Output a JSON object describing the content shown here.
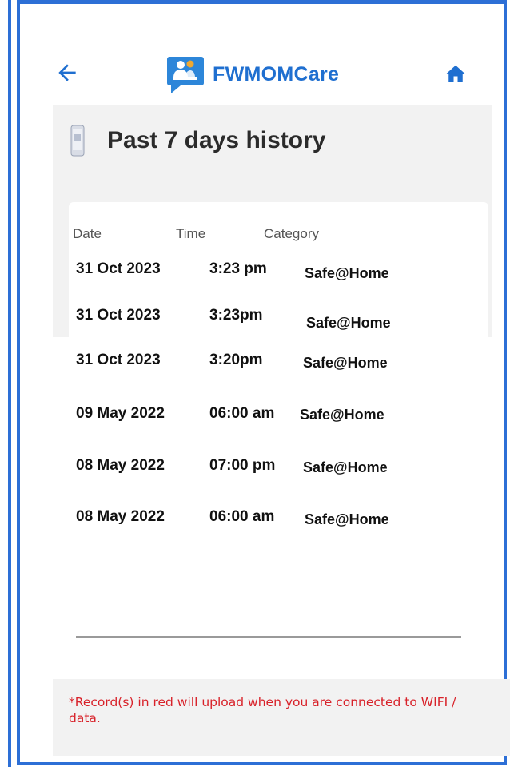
{
  "app": {
    "title": "FWMOMCare"
  },
  "page": {
    "title": "Past 7 days history"
  },
  "table": {
    "headers": [
      "Date",
      "Time",
      "Category"
    ],
    "rows": [
      {
        "date": "31 Oct 2023",
        "time": "3:23 pm",
        "category": "Safe@Home"
      },
      {
        "date": "31 Oct 2023",
        "time": "3:23pm",
        "category": "Safe@Home"
      },
      {
        "date": "31 Oct 2023",
        "time": "3:20pm",
        "category": "Safe@Home"
      },
      {
        "date": "09 May 2022",
        "time": "06:00 am",
        "category": "Safe@Home"
      },
      {
        "date": "08 May 2022",
        "time": "07:00 pm",
        "category": "Safe@Home"
      },
      {
        "date": "08 May 2022",
        "time": "06:00 am",
        "category": "Safe@Home"
      }
    ]
  },
  "footer": {
    "note": "*Record(s) in red will upload when you are connected to WIFI / data."
  },
  "colors": {
    "accent": "#2d6fd6",
    "brand": "#1f6fd0",
    "warning": "#d8222a"
  },
  "icons": {
    "back": "arrow-left-icon",
    "home": "home-icon",
    "logo": "fwmomcare-logo-icon",
    "page": "phone-icon"
  }
}
